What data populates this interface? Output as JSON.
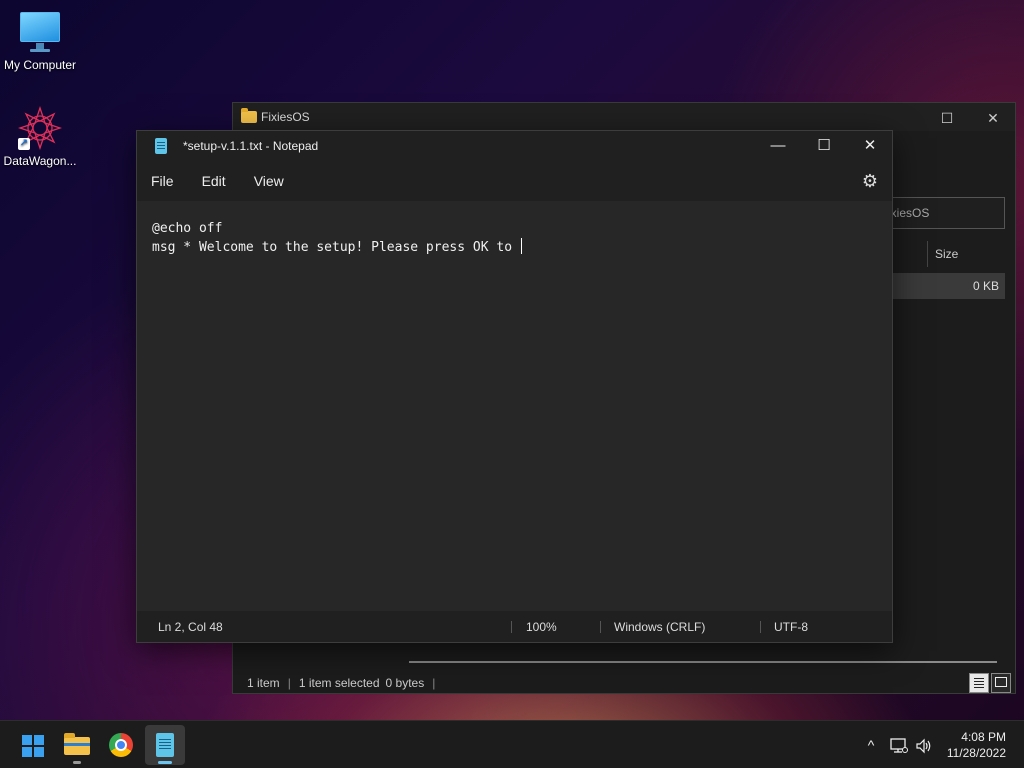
{
  "desktop": {
    "icons": [
      {
        "label": "My Computer",
        "icon": "computer-icon"
      },
      {
        "label": "DataWagon...",
        "icon": "datawagon-icon"
      }
    ]
  },
  "explorer": {
    "title": "FixiesOS",
    "search_placeholder": "ixiesOS",
    "columns": {
      "size": "Size"
    },
    "row": {
      "size": "0 KB"
    },
    "status": {
      "items": "1 item",
      "selected": "1 item selected",
      "bytes": "0 bytes"
    }
  },
  "notepad": {
    "title": "*setup-v.1.1.txt - Notepad",
    "menu": {
      "file": "File",
      "edit": "Edit",
      "view": "View"
    },
    "content": {
      "line1": "@echo off",
      "line2": "msg * Welcome to the setup! Please press OK to "
    },
    "status": {
      "position": "Ln 2, Col 48",
      "zoom": "100%",
      "line_endings": "Windows (CRLF)",
      "encoding": "UTF-8"
    }
  },
  "taskbar": {
    "apps": [
      "start-icon",
      "file-explorer-icon",
      "chrome-icon",
      "notepad-icon"
    ],
    "clock": {
      "time": "4:08 PM",
      "date": "11/28/2022"
    }
  },
  "colors": {
    "accent": "#3aa0f0",
    "window_bg": "#202020",
    "editor_bg": "#272727"
  }
}
